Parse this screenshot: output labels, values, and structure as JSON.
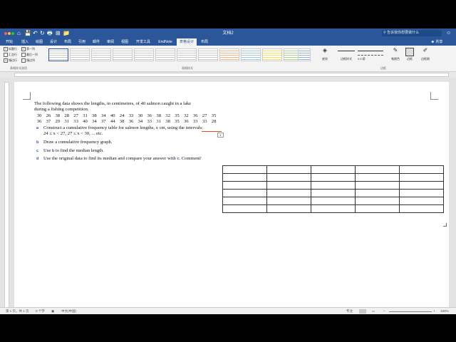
{
  "window": {
    "title": "文档2",
    "search_placeholder": "告诉我你想要做什么",
    "share_label": "共享",
    "quick_access": [
      "⌂",
      "💾",
      "↶",
      "↻",
      "🖶",
      "⊞",
      "📁"
    ]
  },
  "tabs": [
    "开始",
    "插入",
    "绘图",
    "设计",
    "布局",
    "引用",
    "邮件",
    "审阅",
    "视图",
    "开发工具",
    "EndNote",
    "表格设计",
    "布局"
  ],
  "active_tab_index": 11,
  "ribbon": {
    "table_style_options": {
      "col1": [
        "标题行",
        "汇总行",
        "镶边行"
      ],
      "col1_checked": [
        true,
        false,
        true
      ],
      "col2": [
        "第一列",
        "最后一列",
        "镶边列"
      ],
      "col2_checked": [
        true,
        false,
        false
      ],
      "group_label": "表格样式选项"
    },
    "table_styles_group_label": "表格样式",
    "shading_label": "底纹",
    "border_styles_label": "边框样式",
    "pen_weight": "0.5 磅",
    "pen_color_label": "笔颜色",
    "borders_label": "边框",
    "border_painter_label": "边框刷",
    "borders_group_label": "边框"
  },
  "document": {
    "intro_line1": "The following data shows the lengths, in centimetres, of 40 salmon caught in a lake",
    "intro_line2": "during a fishing competition.",
    "data_row1": [
      30,
      26,
      38,
      28,
      27,
      31,
      38,
      34,
      40,
      24,
      33,
      30,
      36,
      38,
      32,
      35,
      32,
      36,
      27,
      35
    ],
    "data_row2": [
      36,
      37,
      29,
      31,
      33,
      40,
      34,
      37,
      44,
      38,
      36,
      34,
      33,
      31,
      38,
      35,
      36,
      33,
      33,
      28
    ],
    "questions": [
      {
        "letter": "a",
        "text": "Construct a cumulative frequency table for salmon lengths,  x cm, using the intervals:"
      },
      {
        "letter": "b",
        "text": "Draw a cumulative frequency graph."
      },
      {
        "letter": "c",
        "text": "to find the median length."
      },
      {
        "letter": "d",
        "text": "Use the original data to find its median and compare your answer with"
      }
    ],
    "question_a_line2": "24 ≤ x < 27,   27 ≤ x < 30, ... etc.",
    "question_c_prefix": "Use",
    "question_c_ref": "b",
    "question_d_ref": "c",
    "question_d_suffix": ". Comment!",
    "table_rows": 6,
    "table_cols": 5
  },
  "status": {
    "page": "第 1 页，共 1 页",
    "words": "0 个字",
    "language": "中文(中国)",
    "focus": "专注",
    "zoom": "160%"
  },
  "colors": {
    "accent": "#2b579a",
    "question_letter": "#2f5fa8"
  }
}
